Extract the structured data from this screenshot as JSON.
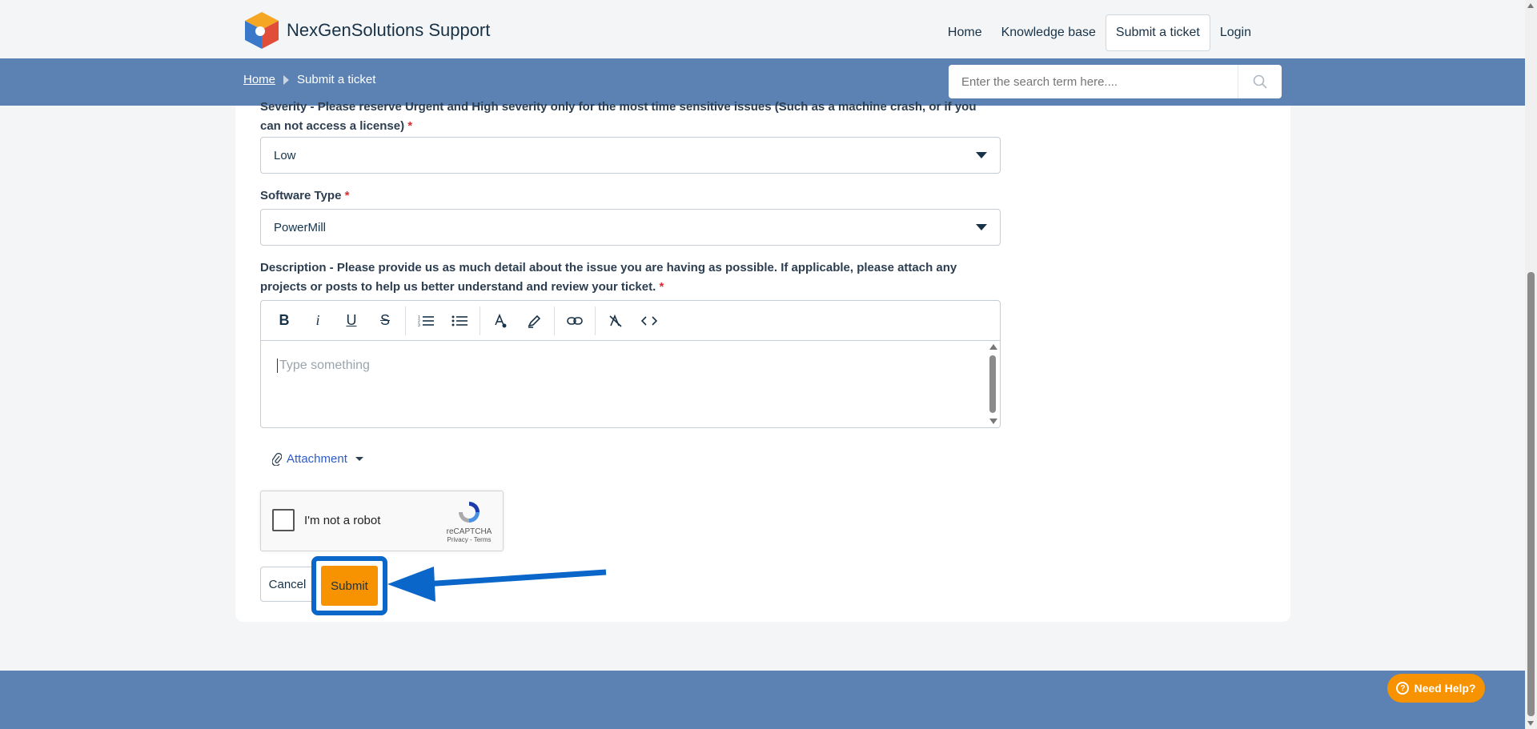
{
  "brand": {
    "name": "NexGenSolutions Support"
  },
  "nav": {
    "items": [
      {
        "label": "Home"
      },
      {
        "label": "Knowledge base"
      },
      {
        "label": "Submit a ticket"
      },
      {
        "label": "Login"
      }
    ]
  },
  "breadcrumb": {
    "home": "Home",
    "current": "Submit a ticket"
  },
  "search": {
    "placeholder": "Enter the search term here...."
  },
  "form": {
    "severity": {
      "label": "Severity - Please reserve Urgent and High severity only for the most time sensitive issues (Such as a machine crash, or if you can not access a license)",
      "required": "*",
      "value": "Low"
    },
    "software": {
      "label": "Software Type",
      "required": "*",
      "value": "PowerMill"
    },
    "description": {
      "label": "Description - Please provide us as much detail about the issue you are having as possible. If applicable, please attach any projects or posts to help us better understand and review your ticket.",
      "required": "*",
      "placeholder": "Type something"
    },
    "attachment": {
      "label": "Attachment"
    },
    "captcha": {
      "label": "I'm not a robot",
      "brand": "reCAPTCHA",
      "links": "Privacy - Terms"
    },
    "cancel_label": "Cancel",
    "submit_label": "Submit"
  },
  "help": {
    "label": "Need Help?"
  },
  "colors": {
    "accent": "#f79300",
    "header_blue": "#5b82b2",
    "annotation_blue": "#0a66c8"
  }
}
